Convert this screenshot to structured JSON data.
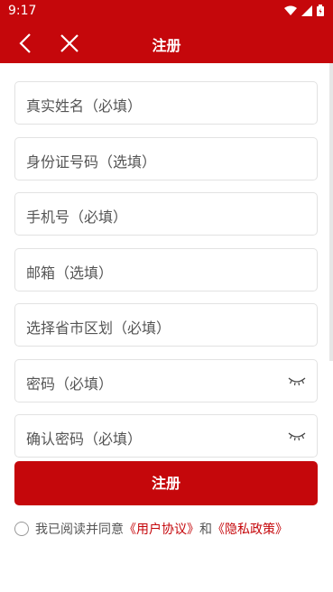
{
  "status": {
    "time": "9:17"
  },
  "header": {
    "title": "注册"
  },
  "form": {
    "fields": [
      {
        "placeholder": "真实姓名（必填）"
      },
      {
        "placeholder": "身份证号码（选填）"
      },
      {
        "placeholder": "手机号（必填）"
      },
      {
        "placeholder": "邮箱（选填）"
      },
      {
        "placeholder": "选择省市区划（必填）"
      },
      {
        "placeholder": "密码（必填）"
      },
      {
        "placeholder": "确认密码（必填）"
      }
    ],
    "submit_label": "注册"
  },
  "agreement": {
    "prefix": "我已阅读并同意",
    "user_agreement": "《用户协议》",
    "and": "和",
    "privacy_policy": "《隐私政策》"
  },
  "colors": {
    "brand": "#c5070b"
  },
  "icons": {
    "back": "chevron-left-icon",
    "close": "close-icon",
    "password_toggle": "eye-closed-icon"
  }
}
